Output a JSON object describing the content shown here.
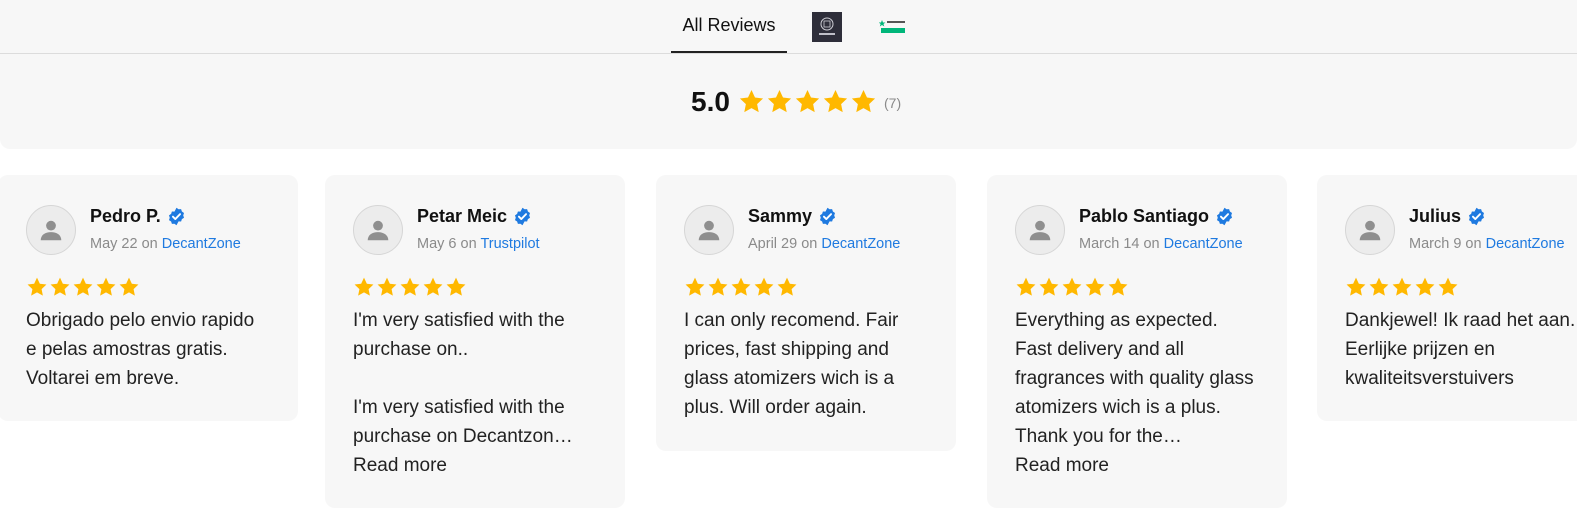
{
  "tabs": {
    "all_label": "All Reviews",
    "logo1_icon": "decantzone-logo-icon",
    "logo2_icon": "trustpilot-logo-icon"
  },
  "summary": {
    "rating": "5.0",
    "stars": 5,
    "count": "(7)"
  },
  "colors": {
    "star": "#FFB800",
    "verified": "#1F7AE0",
    "link": "#1F7AE0",
    "card_bg": "#F7F7F7"
  },
  "reviews": [
    {
      "name": "Pedro P.",
      "date": "May 22",
      "on": "on",
      "source": "DecantZone",
      "stars": 5,
      "text": "Obrigado pelo envio rapido e pelas amostras gratis. Voltarei em breve.",
      "read_more": ""
    },
    {
      "name": "Petar Meic",
      "date": "May 6",
      "on": "on",
      "source": "Trustpilot",
      "stars": 5,
      "text": "I'm very satisfied with the purchase on..\n\nI'm very satisfied with the purchase on Decantzon…",
      "read_more": "Read more"
    },
    {
      "name": "Sammy",
      "date": "April 29",
      "on": "on",
      "source": "DecantZone",
      "stars": 5,
      "text": "I can only recomend. Fair prices, fast shipping and glass atomizers wich is a plus. Will order again.",
      "read_more": ""
    },
    {
      "name": "Pablo Santiago",
      "date": "March 14",
      "on": "on",
      "source": "DecantZone",
      "stars": 5,
      "text": "Everything as expected. Fast delivery and all fragrances with quality glass atomizers wich is a plus. Thank you for the…",
      "read_more": "Read more"
    },
    {
      "name": "Julius",
      "date": "March 9",
      "on": "on",
      "source": "DecantZone",
      "stars": 5,
      "text": "Dankjewel! Ik raad het aan. Eerlijke prijzen en kwaliteitsverstuivers",
      "read_more": ""
    }
  ]
}
